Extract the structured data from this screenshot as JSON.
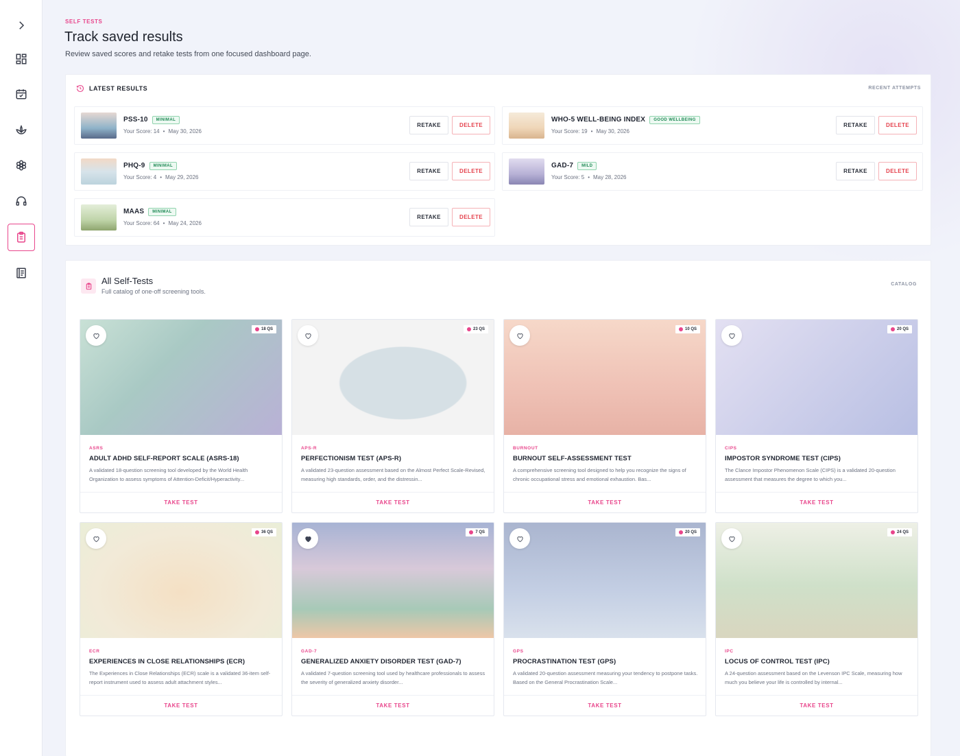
{
  "header": {
    "eyebrow": "SELF TESTS",
    "title": "Track saved results",
    "subtitle": "Review saved scores and retake tests from one focused dashboard page."
  },
  "sidebar": {
    "items": [
      {
        "icon": "chevron-right-icon"
      },
      {
        "icon": "dashboard-icon"
      },
      {
        "icon": "calendar-check-icon"
      },
      {
        "icon": "lotus-icon"
      },
      {
        "icon": "flower-icon"
      },
      {
        "icon": "headphones-icon"
      },
      {
        "icon": "clipboard-icon",
        "active": true
      },
      {
        "icon": "journal-icon"
      }
    ]
  },
  "latest": {
    "heading": "LATEST RESULTS",
    "link": "RECENT ATTEMPTS",
    "retake_label": "RETAKE",
    "delete_label": "DELETE",
    "results": [
      {
        "name": "PSS-10",
        "badge": "MINIMAL",
        "score": "Your Score: 14",
        "date": "May 30, 2026"
      },
      {
        "name": "WHO-5 WELL-BEING INDEX",
        "badge": "GOOD WELLBEING",
        "score": "Your Score: 19",
        "date": "May 30, 2026"
      },
      {
        "name": "PHQ-9",
        "badge": "MINIMAL",
        "score": "Your Score: 4",
        "date": "May 29, 2026"
      },
      {
        "name": "GAD-7",
        "badge": "MILD",
        "score": "Your Score: 5",
        "date": "May 28, 2026"
      },
      {
        "name": "MAAS",
        "badge": "MINIMAL",
        "score": "Your Score: 64",
        "date": "May 24, 2026"
      }
    ]
  },
  "catalog": {
    "title": "All Self-Tests",
    "subtitle": "Full catalog of one-off screening tools.",
    "link": "CATALOG",
    "take_label": "TAKE TEST",
    "tests": [
      {
        "code": "ASRS",
        "name": "ADULT ADHD SELF-REPORT SCALE (ASRS-18)",
        "questions": "18 QS",
        "favorite": false,
        "desc": "A validated 18-question screening tool developed by the World Health Organization to assess symptoms of Attention-Deficit/Hyperactivity..."
      },
      {
        "code": "APS-R",
        "name": "PERFECTIONISM TEST (APS-R)",
        "questions": "23 QS",
        "favorite": false,
        "desc": "A validated 23-question assessment based on the Almost Perfect Scale-Revised, measuring high standards, order, and the distressin..."
      },
      {
        "code": "BURNOUT",
        "name": "BURNOUT SELF-ASSESSMENT TEST",
        "questions": "10 QS",
        "favorite": false,
        "desc": "A comprehensive screening tool designed to help you recognize the signs of chronic occupational stress and emotional exhaustion. Bas..."
      },
      {
        "code": "CIPS",
        "name": "IMPOSTOR SYNDROME TEST (CIPS)",
        "questions": "20 QS",
        "favorite": false,
        "desc": "The Clance Impostor Phenomenon Scale (CIPS) is a validated 20-question assessment that measures the degree to which you..."
      },
      {
        "code": "ECR",
        "name": "EXPERIENCES IN CLOSE RELATIONSHIPS (ECR)",
        "questions": "36 QS",
        "favorite": false,
        "desc": "The Experiences in Close Relationships (ECR) scale is a validated 36-item self-report instrument used to assess adult attachment styles..."
      },
      {
        "code": "GAD-7",
        "name": "GENERALIZED ANXIETY DISORDER TEST (GAD-7)",
        "questions": "7 QS",
        "favorite": true,
        "desc": "A validated 7-question screening tool used by healthcare professionals to assess the severity of generalized anxiety disorder..."
      },
      {
        "code": "GPS",
        "name": "PROCRASTINATION TEST (GPS)",
        "questions": "20 QS",
        "favorite": false,
        "desc": "A validated 20-question assessment measuring your tendency to postpone tasks. Based on the General Procrastination Scale..."
      },
      {
        "code": "IPC",
        "name": "LOCUS OF CONTROL TEST (IPC)",
        "questions": "24 QS",
        "favorite": false,
        "desc": "A 24-question assessment based on the Levenson IPC Scale, measuring how much you believe your life is controlled by internal..."
      }
    ]
  },
  "colors": {
    "accent": "#e8458b",
    "delete": "#e5424d",
    "badge": "#1f8a55"
  }
}
